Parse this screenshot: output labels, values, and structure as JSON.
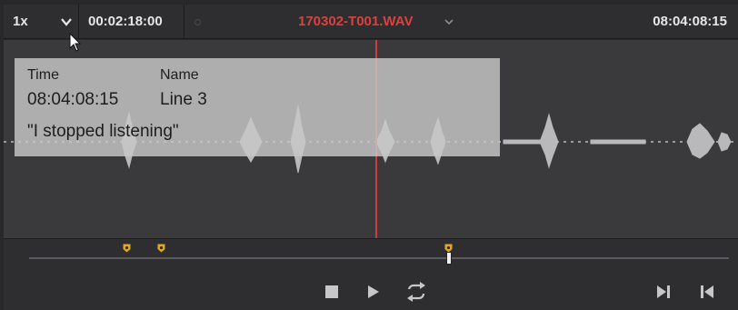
{
  "toolbar": {
    "speed": "1x",
    "source_timecode": "00:02:18:00",
    "clip_name": "170302-T001.WAV",
    "record_timecode": "08:04:08:15"
  },
  "tooltip": {
    "time_header": "Time",
    "name_header": "Name",
    "time_value": "08:04:08:15",
    "name_value": "Line 3",
    "note": "\"I stopped listening\""
  },
  "icons": {
    "speed_dropdown": "chevron-down-icon",
    "clip_dropdown": "chevron-down-icon",
    "cursor": "mouse-pointer-icon",
    "stop": "stop-icon",
    "play": "play-icon",
    "loop": "loop-icon",
    "next": "skip-forward-icon",
    "previous": "skip-back-icon"
  },
  "colors": {
    "clip_name": "#d8423f",
    "playhead": "#cf3b3b",
    "marker": "#e2a823",
    "waveform": "#b9b9bc"
  }
}
